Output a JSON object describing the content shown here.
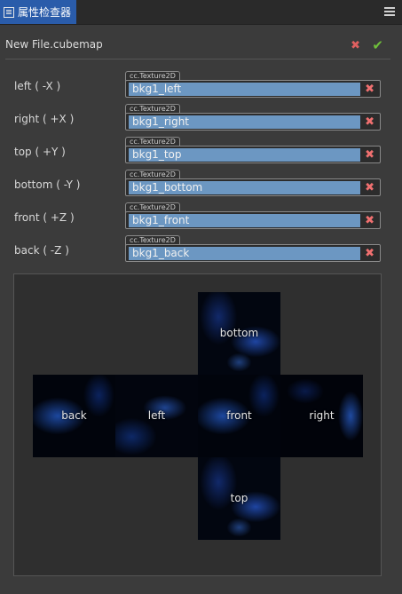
{
  "panel": {
    "tab_title": "属性检查器",
    "tab_icon": "panel-icon",
    "menu_icon": "hamburger-menu-icon"
  },
  "header": {
    "file_name": "New File.cubemap",
    "revert_symbol": "✖",
    "apply_symbol": "✔"
  },
  "asset_type": "cc.Texture2D",
  "clear_symbol": "✖",
  "faces": [
    {
      "label": "left ( -X )",
      "value": "bkg1_left"
    },
    {
      "label": "right ( +X )",
      "value": "bkg1_right"
    },
    {
      "label": "top ( +Y )",
      "value": "bkg1_top"
    },
    {
      "label": "bottom ( -Y )",
      "value": "bkg1_bottom"
    },
    {
      "label": "front ( +Z )",
      "value": "bkg1_front"
    },
    {
      "label": "back ( -Z )",
      "value": "bkg1_back"
    }
  ],
  "preview": {
    "bottom": "bottom",
    "back": "back",
    "left": "left",
    "front": "front",
    "right": "right",
    "top": "top"
  }
}
